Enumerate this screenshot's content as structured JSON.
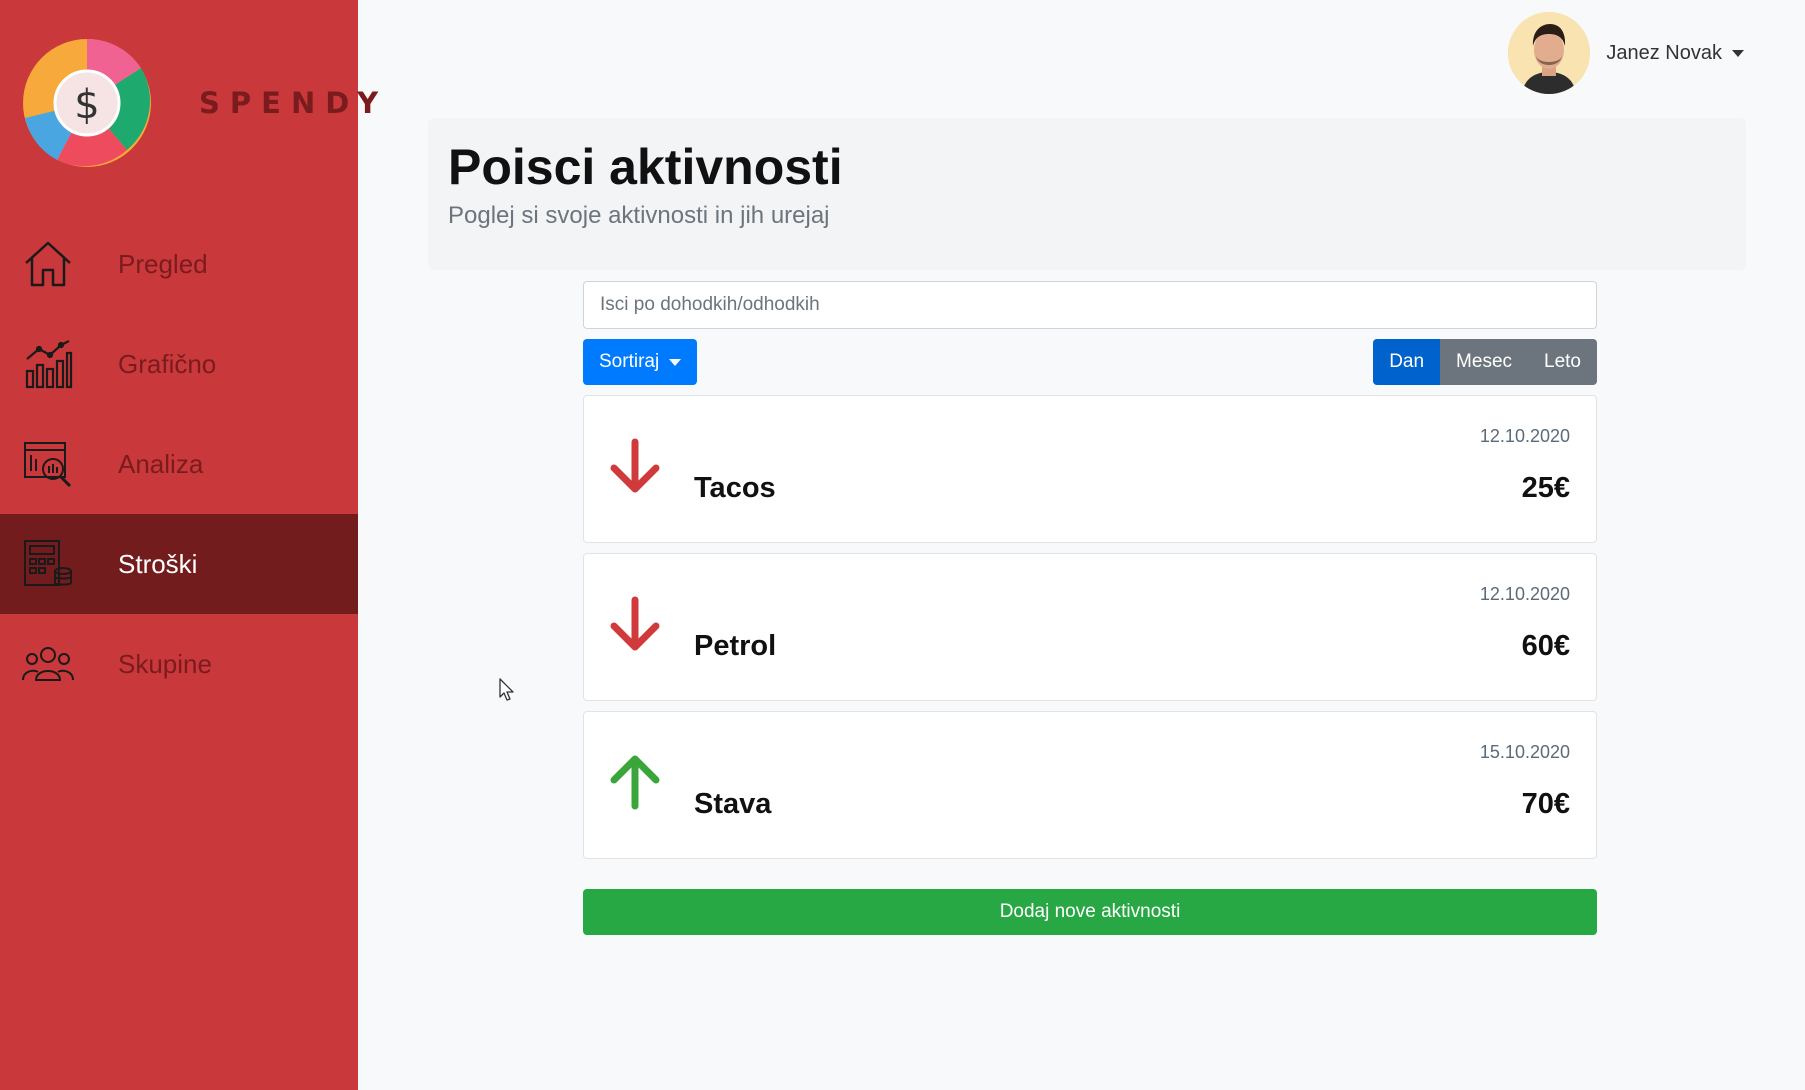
{
  "app": {
    "brand": "SPENDY"
  },
  "sidebar": {
    "items": [
      {
        "label": "Pregled",
        "icon": "home-icon"
      },
      {
        "label": "Grafično",
        "icon": "chart-icon"
      },
      {
        "label": "Analiza",
        "icon": "analysis-icon"
      },
      {
        "label": "Stroški",
        "icon": "expenses-icon",
        "active": true
      },
      {
        "label": "Skupine",
        "icon": "group-icon"
      }
    ]
  },
  "header": {
    "user_name": "Janez Novak"
  },
  "page": {
    "title": "Poisci aktivnosti",
    "subtitle": "Poglej si svoje aktivnosti in jih urejaj"
  },
  "search": {
    "placeholder": "Isci po dohodkih/odhodkih",
    "value": ""
  },
  "sort": {
    "label": "Sortiraj"
  },
  "period": {
    "options": [
      "Dan",
      "Mesec",
      "Leto"
    ],
    "selected": "Dan"
  },
  "activities": [
    {
      "name": "Tacos",
      "date": "12.10.2020",
      "amount": "25€",
      "direction": "down"
    },
    {
      "name": "Petrol",
      "date": "12.10.2020",
      "amount": "60€",
      "direction": "down"
    },
    {
      "name": "Stava",
      "date": "15.10.2020",
      "amount": "70€",
      "direction": "up"
    }
  ],
  "add_button": {
    "label": "Dodaj nove aktivnosti"
  },
  "colors": {
    "sidebar": "#c9383a",
    "sidebar_active": "#721c1e",
    "primary": "#007bff",
    "success": "#28a745",
    "expense_arrow": "#d03a3a",
    "income_arrow": "#3aa63a"
  }
}
